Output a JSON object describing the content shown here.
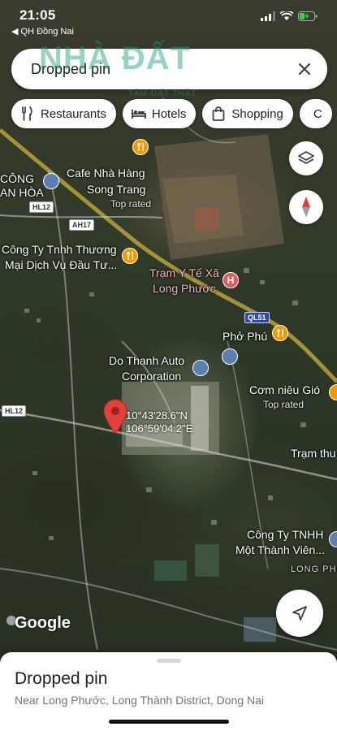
{
  "status_bar": {
    "time": "21:05",
    "back_app": "◀ QH Đồng Nai"
  },
  "search": {
    "value": "Dropped pin",
    "close_icon": "close-icon"
  },
  "watermark": {
    "text": "NHÀ ĐẤT",
    "sub": "TÂM ĐẤT THẬT"
  },
  "chips": [
    {
      "label": "Restaurants",
      "icon": "fork-knife-icon"
    },
    {
      "label": "Hotels",
      "icon": "bed-icon"
    },
    {
      "label": "Shopping",
      "icon": "shopping-bag-icon"
    },
    {
      "label": "C",
      "icon": "coffee-icon"
    }
  ],
  "map_labels": {
    "cafe": "Cafe Nhà Hàng",
    "cafe2": "Song Trang",
    "top_rated_1": "Top rated",
    "cong_left": "CÔNG",
    "cong_left2": "AN HÒA",
    "company_tm": "Công Ty Tnhh Thương",
    "company_tm2": "Mại Dịch Vụ Đầu Tư...",
    "tram": "Trạm Y Tế Xã",
    "tram2": "Long Phước",
    "pho": "Phở Phú",
    "do_thanh": "Do Thanh Auto",
    "do_thanh2": "Corporation",
    "com_nieu": "Cơm niêu Gió",
    "top_rated_2": "Top rated",
    "tram_thu": "Trạm thu",
    "company_tnhh": "Công Ty TNHH",
    "company_tnhh2": "Một Thành Viên...",
    "long_phuoc_caps": "LONG PHƯỚ"
  },
  "road_badges": {
    "hl12_top": "HL12",
    "ah17": "AH17",
    "ql51": "QL51",
    "hl12_left": "HL12"
  },
  "pin": {
    "lat": "10°43'28.6\"N",
    "lng": "106°59'04.2\"E",
    "color": "#e0413a"
  },
  "google_logo": "Google",
  "sheet": {
    "title": "Dropped pin",
    "subtitle": "Near Long Phước, Long Thành District, Dong Nai"
  }
}
